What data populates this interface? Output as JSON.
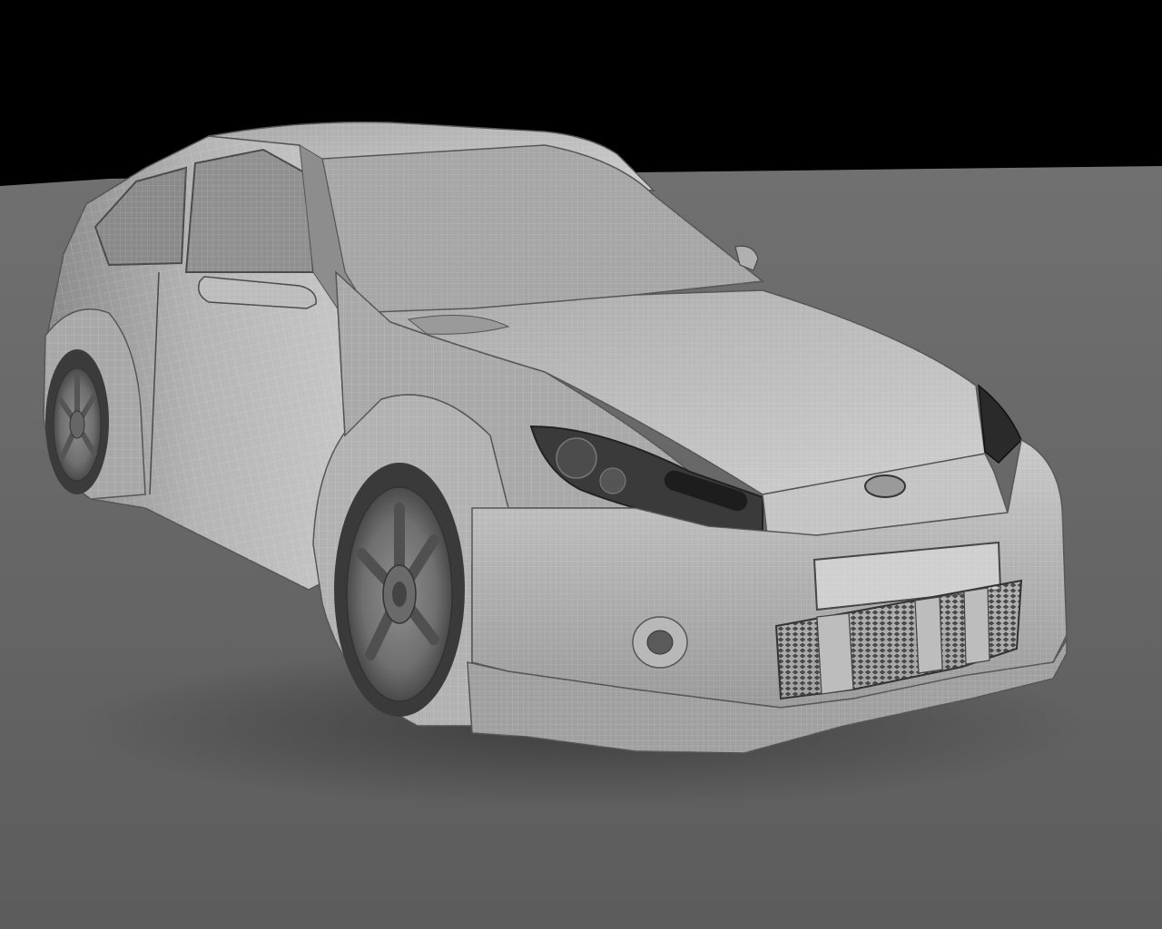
{
  "scene": {
    "subject": "wireframe-render-hatchback-rally-car",
    "colors": {
      "sky": "#000000",
      "ground_top": "#6f6f6f",
      "ground_bottom": "#5c5c5c",
      "body_light": "#bdbdbd",
      "body_mid": "#9c9c9c",
      "body_dark": "#6a6a6a",
      "glass": "#8f8f8f",
      "tire": "#3a3a3a",
      "headlight": "#2a2a2a",
      "wire": "#ffffff",
      "shadow": "#3d3d3d"
    },
    "icons": {
      "emblem": "oval-emblem-icon"
    }
  }
}
